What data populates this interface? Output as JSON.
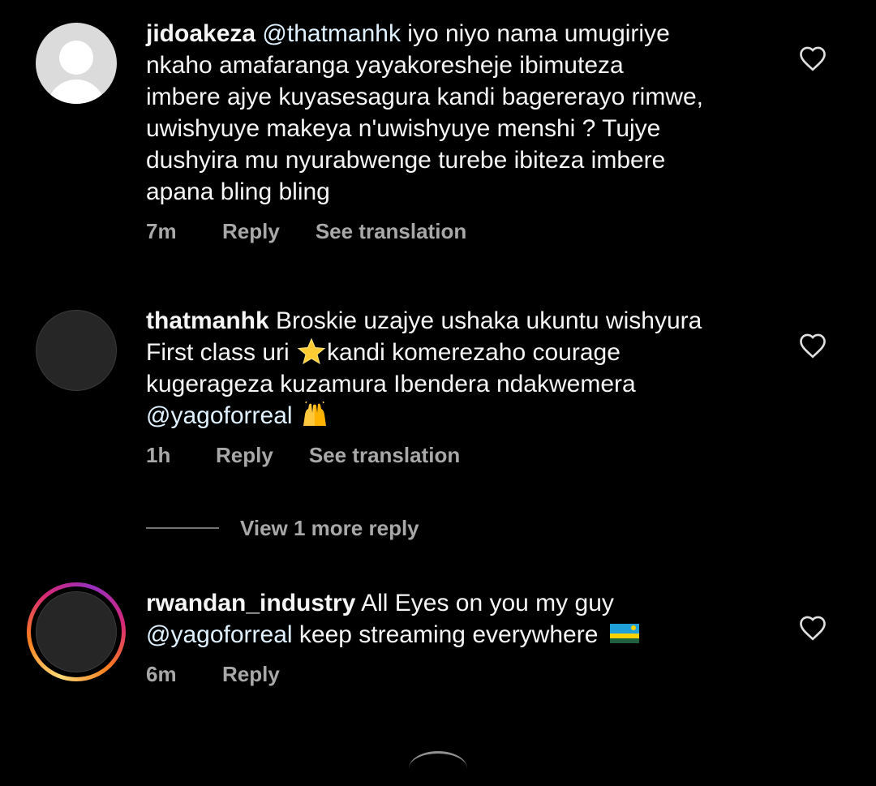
{
  "comments": [
    {
      "username": "jidoakeza",
      "mention": "@thatmanhk",
      "text": " iyo niyo nama umugiriye\nnkaho amafaranga yayakoresheje ibimuteza\nimbere ajye kuyasesagura kandi bagererayo rimwe,\nuwishyuye makeya n'uwishyuye menshi ? Tujye\ndushyira mu nyurabwenge turebe ibiteza imbere\napana bling bling",
      "time": "7m",
      "reply_label": "Reply",
      "translation_label": "See translation",
      "avatar": "default-avatar-icon"
    },
    {
      "username": "thatmanhk",
      "text_part1": " Broskie uzajye ushaka ukuntu wishyura\nFirst class uri ",
      "emoji1": "glowing-star-emoji",
      "text_part2": "kandi komerezaho courage\nkugerageza kuzamura Ibendera ndakwemera\n",
      "mention": "@yagoforreal",
      "emoji2": "raising-hands-emoji",
      "time": "1h",
      "reply_label": "Reply",
      "translation_label": "See translation",
      "view_more": "View 1 more reply"
    },
    {
      "username": "rwandan_industry",
      "text_part1": " All Eyes on you my guy\n",
      "mention": "@yagoforreal",
      "text_part2": " keep streaming everywhere ",
      "emoji": "rwanda-flag-emoji",
      "time": "6m",
      "reply_label": "Reply"
    }
  ],
  "colors": {
    "background": "#000000",
    "text": "#f5f5f5",
    "secondary": "#a8a8a8",
    "mention": "#e0f1ff"
  }
}
